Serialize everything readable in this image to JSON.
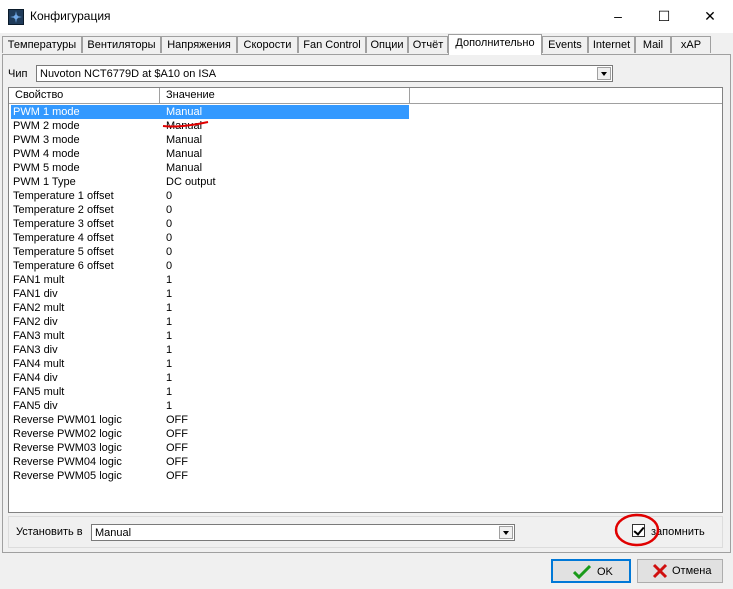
{
  "window": {
    "title": "Конфигурация",
    "minimize": "–",
    "maximize": "☐",
    "close": "✕"
  },
  "tabs": [
    {
      "label": "Температуры"
    },
    {
      "label": "Вентиляторы"
    },
    {
      "label": "Напряжения"
    },
    {
      "label": "Скорости"
    },
    {
      "label": "Fan Control"
    },
    {
      "label": "Опции"
    },
    {
      "label": "Отчёт"
    },
    {
      "label": "Дополнительно",
      "active": true
    },
    {
      "label": "Events"
    },
    {
      "label": "Internet"
    },
    {
      "label": "Mail"
    },
    {
      "label": "xAP"
    }
  ],
  "chip": {
    "label": "Чип",
    "value": "Nuvoton NCT6779D at $A10 on ISA"
  },
  "grid": {
    "headers": {
      "property": "Свойство",
      "value": "Значение"
    },
    "rows": [
      {
        "name": "PWM 1 mode",
        "value": "Manual",
        "selected": true
      },
      {
        "name": "PWM 2 mode",
        "value": "Manual"
      },
      {
        "name": "PWM 3 mode",
        "value": "Manual"
      },
      {
        "name": "PWM 4 mode",
        "value": "Manual"
      },
      {
        "name": "PWM 5 mode",
        "value": "Manual"
      },
      {
        "name": "PWM 1 Type",
        "value": "DC output"
      },
      {
        "name": "Temperature 1 offset",
        "value": "0"
      },
      {
        "name": "Temperature 2 offset",
        "value": "0"
      },
      {
        "name": "Temperature 3 offset",
        "value": "0"
      },
      {
        "name": "Temperature 4 offset",
        "value": "0"
      },
      {
        "name": "Temperature 5 offset",
        "value": "0"
      },
      {
        "name": "Temperature 6 offset",
        "value": "0"
      },
      {
        "name": "FAN1 mult",
        "value": "1"
      },
      {
        "name": "FAN1 div",
        "value": "1"
      },
      {
        "name": "FAN2 mult",
        "value": "1"
      },
      {
        "name": "FAN2 div",
        "value": "1"
      },
      {
        "name": "FAN3 mult",
        "value": "1"
      },
      {
        "name": "FAN3 div",
        "value": "1"
      },
      {
        "name": "FAN4 mult",
        "value": "1"
      },
      {
        "name": "FAN4 div",
        "value": "1"
      },
      {
        "name": "FAN5 mult",
        "value": "1"
      },
      {
        "name": "FAN5 div",
        "value": "1"
      },
      {
        "name": "Reverse PWM01 logic",
        "value": "OFF"
      },
      {
        "name": "Reverse PWM02 logic",
        "value": "OFF"
      },
      {
        "name": "Reverse PWM03 logic",
        "value": "OFF"
      },
      {
        "name": "Reverse PWM04 logic",
        "value": "OFF"
      },
      {
        "name": "Reverse PWM05 logic",
        "value": "OFF"
      }
    ]
  },
  "set": {
    "label": "Установить в",
    "value": "Manual"
  },
  "remember": {
    "label": "запомнить",
    "checked": true
  },
  "buttons": {
    "ok": "OK",
    "cancel": "Отмена"
  },
  "colors": {
    "selection": "#3399ff",
    "annotation": "#e00000",
    "ok_check": "#1a9a1a",
    "cancel_x": "#d01010"
  }
}
